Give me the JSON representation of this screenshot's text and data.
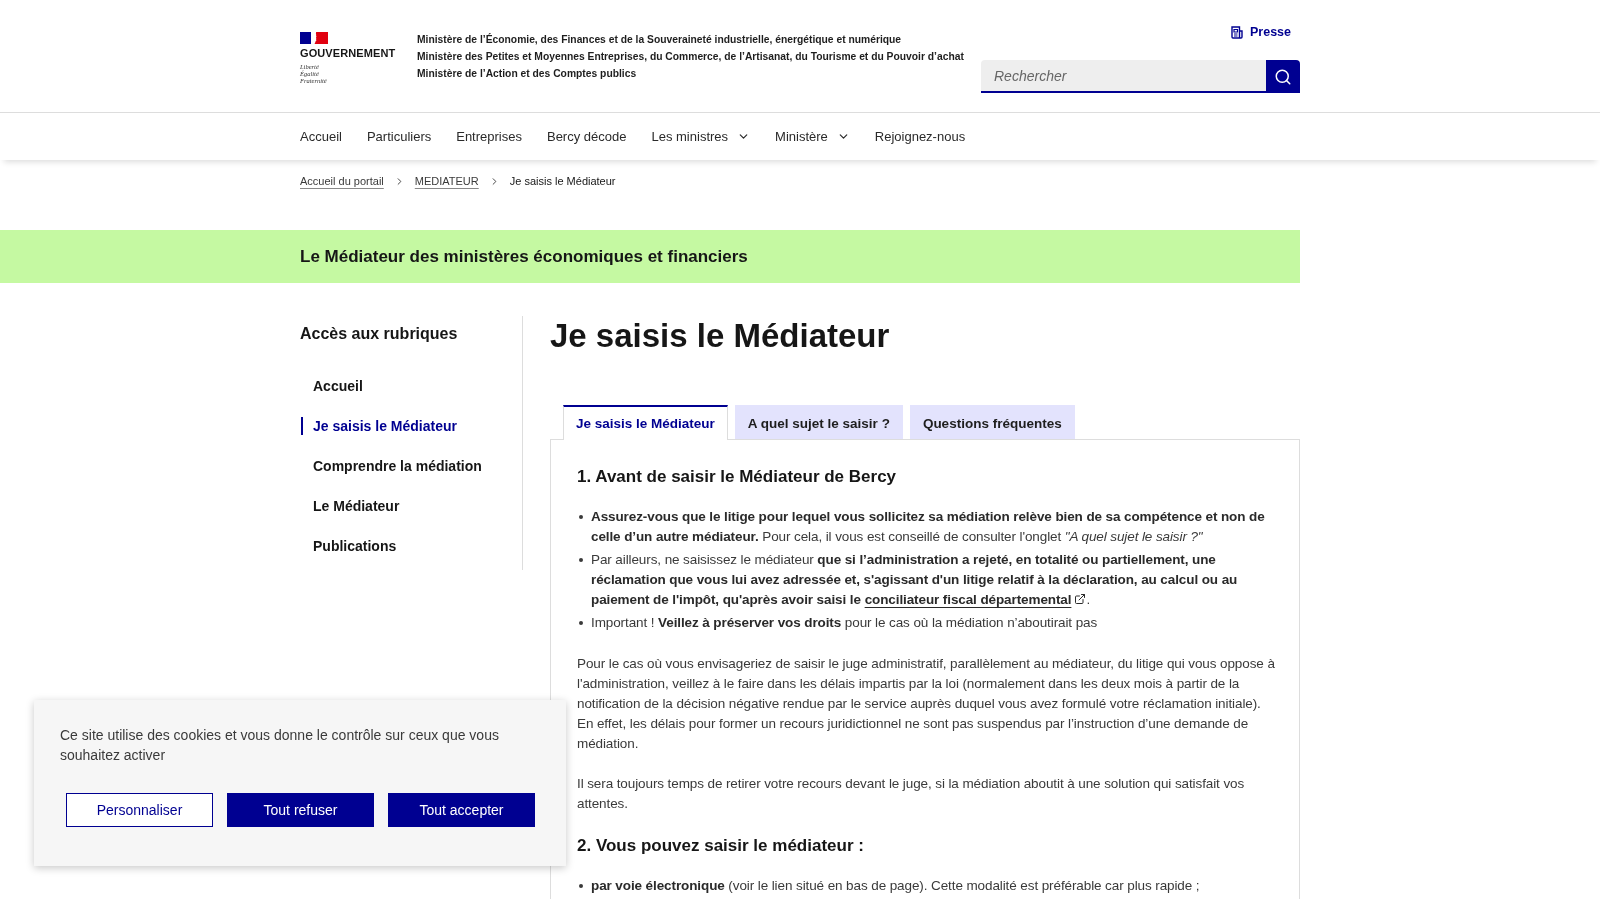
{
  "header": {
    "logo": {
      "name": "GOUVERNEMENT",
      "motto": [
        "Liberté",
        "Égalité",
        "Fraternité"
      ]
    },
    "ministries": [
      "Ministère de l’Économie, des Finances et de la Souveraineté industrielle, énergétique et numérique",
      "Ministère des Petites et Moyennes Entreprises, du Commerce, de l’Artisanat, du Tourisme et du Pouvoir d’achat",
      "Ministère de l’Action et des Comptes publics"
    ],
    "press_link": "Presse",
    "search": {
      "placeholder": "Rechercher"
    }
  },
  "nav": [
    {
      "label": "Accueil",
      "dropdown": false
    },
    {
      "label": "Particuliers",
      "dropdown": false
    },
    {
      "label": "Entreprises",
      "dropdown": false
    },
    {
      "label": "Bercy décode",
      "dropdown": false
    },
    {
      "label": "Les ministres",
      "dropdown": true
    },
    {
      "label": "Ministère",
      "dropdown": true
    },
    {
      "label": "Rejoignez-nous",
      "dropdown": false
    }
  ],
  "breadcrumb": [
    {
      "label": "Accueil du portail",
      "current": false
    },
    {
      "label": "MEDIATEUR",
      "current": false
    },
    {
      "label": "Je saisis le Médiateur",
      "current": true
    }
  ],
  "banner": {
    "title": "Le Médiateur des ministères économiques et financiers"
  },
  "sidebar": {
    "title": "Accès aux rubriques",
    "items": [
      {
        "label": "Accueil",
        "selected": false
      },
      {
        "label": "Je saisis le Médiateur",
        "selected": true
      },
      {
        "label": "Comprendre la médiation",
        "selected": false
      },
      {
        "label": "Le Médiateur",
        "selected": false
      },
      {
        "label": "Publications",
        "selected": false
      }
    ]
  },
  "page_title": "Je saisis le Médiateur",
  "tabs": [
    {
      "label": "Je saisis le Médiateur",
      "selected": true
    },
    {
      "label": "A quel sujet le saisir ?",
      "selected": false
    },
    {
      "label": "Questions fréquentes",
      "selected": false
    }
  ],
  "panel": {
    "sections": [
      {
        "kind": "heading",
        "text": "1. Avant de saisir le Médiateur de Bercy"
      },
      {
        "kind": "list",
        "items": [
          {
            "text": "**Assurez-vous que le litige pour lequel vous sollicitez sa médiation relève bien de sa compétence et non de celle d’un autre médiateur.** Pour cela, il vous est conseillé de consulter l'onglet *\"A quel sujet le saisir ?\"*"
          },
          {
            "text": "Par ailleurs, ne saisissez le médiateur **que si l’administration a rejeté, en totalité ou partiellement, une réclamation que vous lui avez adressée et, s'agissant d'un litige relatif à la déclaration, au calcul ou au paiement de l'impôt, qu'après avoir saisi le**",
            "link": "conciliateur fiscal départemental",
            "after": "."
          },
          {
            "text": "Important ! **Veillez à préserver vos droits** pour le cas où la médiation n’aboutirait pas"
          }
        ]
      },
      {
        "kind": "paragraph",
        "text": "Pour le cas où vous envisageriez de saisir le juge administratif, parallèlement au médiateur, du litige qui vous oppose à l'administration, veillez à le faire dans les délais impartis par la loi (normalement dans les deux mois à partir de la notification de la décision négative rendue par le service auprès duquel vous avez formulé votre réclamation initiale). En effet, les délais pour former un recours juridictionnel ne sont pas suspendus par l’instruction d’une demande de médiation."
      },
      {
        "kind": "paragraph",
        "text": "Il sera toujours temps de retirer votre recours devant le juge, si la médiation aboutit à une solution qui satisfait vos attentes."
      },
      {
        "kind": "heading",
        "text": "2. Vous pouvez saisir le médiateur :"
      },
      {
        "kind": "list",
        "items": [
          {
            "text": "**par voie électronique** (voir le lien situé en bas de page). Cette modalité est préférable car plus rapide ;"
          }
        ]
      }
    ]
  },
  "cookie_banner": {
    "message": "Ce site utilise des cookies et vous donne le contrôle sur ceux que vous souhaitez activer",
    "buttons": [
      {
        "label": "Personnaliser",
        "kind": "secondary"
      },
      {
        "label": "Tout refuser",
        "kind": "primary"
      },
      {
        "label": "Tout accepter",
        "kind": "primary"
      }
    ]
  }
}
